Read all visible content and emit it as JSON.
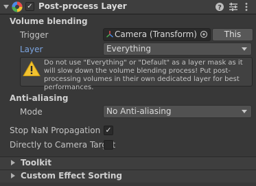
{
  "header": {
    "title": "Post-process Layer",
    "enabled_check": "✓",
    "icons": [
      "help-icon",
      "preset-icon",
      "overflow-menu-icon"
    ]
  },
  "volume_blending": {
    "section_label": "Volume blending",
    "trigger_label": "Trigger",
    "trigger_value": "Camera (Transform)",
    "this_button": "This",
    "layer_label": "Layer",
    "layer_value": "Everything",
    "warning_text": "Do not use \"Everything\" or \"Default\" as a layer mask as it will slow down the volume blending process! Put post-processing volumes in their own dedicated layer for best performances."
  },
  "anti_aliasing": {
    "section_label": "Anti-aliasing",
    "mode_label": "Mode",
    "mode_value": "No Anti-aliasing"
  },
  "stop_nan": {
    "label": "Stop NaN Propagation",
    "checked": true,
    "check_glyph": "✓"
  },
  "direct_to_target": {
    "label": "Directly to Camera Target",
    "checked": false
  },
  "sections": {
    "toolkit": "Toolkit",
    "custom_effect_sorting": "Custom Effect Sorting"
  },
  "colors": {
    "background": "#383838",
    "layer_label_blue": "#7ba4e0",
    "warning_yellow": "#f2c230"
  }
}
